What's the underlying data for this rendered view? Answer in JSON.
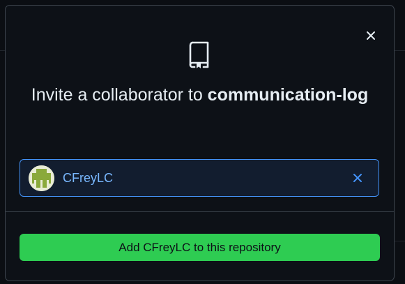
{
  "dialog": {
    "title_prefix": "Invite a collaborator to ",
    "repo_name": "communication-log",
    "close_icon": "close-icon",
    "repo_icon": "repo-icon"
  },
  "invitee": {
    "username": "CFreyLC",
    "remove_icon": "remove-icon",
    "accent_color": "#4493f8"
  },
  "actions": {
    "add_button_label": "Add CFreyLC to this repository",
    "add_button_color": "#2ecc52"
  }
}
